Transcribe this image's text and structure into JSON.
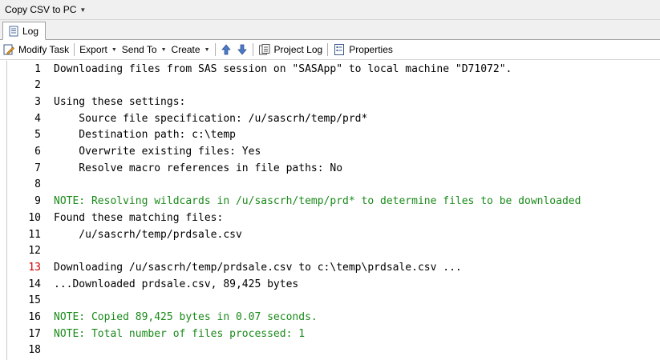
{
  "window": {
    "title": "Copy CSV to PC"
  },
  "tabs": [
    {
      "label": "Log"
    }
  ],
  "toolbar": {
    "modify_task": "Modify Task",
    "export": "Export",
    "send_to": "Send To",
    "create": "Create",
    "project_log": "Project Log",
    "properties": "Properties"
  },
  "log": {
    "lines": [
      {
        "n": "1",
        "text": "Downloading files from SAS session on \"SASApp\" to local machine \"D71072\".",
        "note": false
      },
      {
        "n": "2",
        "text": "",
        "note": false
      },
      {
        "n": "3",
        "text": "Using these settings:",
        "note": false
      },
      {
        "n": "4",
        "text": "    Source file specification: /u/sascrh/temp/prd*",
        "note": false
      },
      {
        "n": "5",
        "text": "    Destination path: c:\\temp",
        "note": false
      },
      {
        "n": "6",
        "text": "    Overwrite existing files: Yes",
        "note": false
      },
      {
        "n": "7",
        "text": "    Resolve macro references in file paths: No",
        "note": false
      },
      {
        "n": "8",
        "text": "",
        "note": false
      },
      {
        "n": "9",
        "text": "NOTE: Resolving wildcards in /u/sascrh/temp/prd* to determine files to be downloaded",
        "note": true
      },
      {
        "n": "10",
        "text": "Found these matching files:",
        "note": false
      },
      {
        "n": "11",
        "text": "    /u/sascrh/temp/prdsale.csv",
        "note": false
      },
      {
        "n": "12",
        "text": "",
        "note": false
      },
      {
        "n": "13",
        "text": "Downloading /u/sascrh/temp/prdsale.csv to c:\\temp\\prdsale.csv ...",
        "note": false,
        "red": true
      },
      {
        "n": "14",
        "text": "...Downloaded prdsale.csv, 89,425 bytes",
        "note": false
      },
      {
        "n": "15",
        "text": "",
        "note": false
      },
      {
        "n": "16",
        "text": "NOTE: Copied 89,425 bytes in 0.07 seconds.",
        "note": true
      },
      {
        "n": "17",
        "text": "NOTE: Total number of files processed: 1",
        "note": true
      },
      {
        "n": "18",
        "text": "",
        "note": false
      }
    ]
  }
}
